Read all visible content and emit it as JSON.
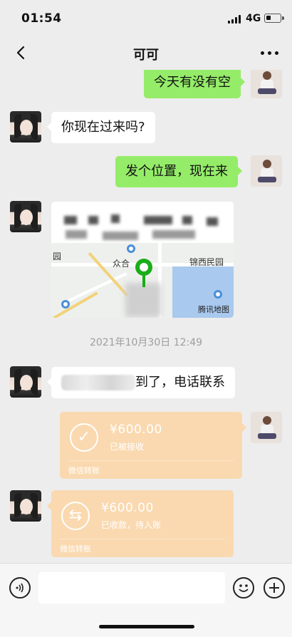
{
  "status": {
    "time": "01:54",
    "network": "4G"
  },
  "header": {
    "title": "可可"
  },
  "messages": {
    "m1": "今天有没有空",
    "m2": "你现在过来吗?",
    "m3": "发个位置，现在来",
    "map_labels": [
      "园",
      "众合",
      "锦西民园",
      "腾讯地图"
    ],
    "timestamp": "2021年10月30日 12:49",
    "m5": "到了，电话联系",
    "transfer1": {
      "amount": "¥600.00",
      "status": "已被接收",
      "footer": "微信转账"
    },
    "transfer2": {
      "amount": "¥600.00",
      "status": "已收款，待入账",
      "footer": "微信转账"
    }
  },
  "input": {
    "placeholder": ""
  },
  "colors": {
    "bubble_green": "#95ec69",
    "transfer_orange": "#fad9b0",
    "background": "#ededed"
  }
}
